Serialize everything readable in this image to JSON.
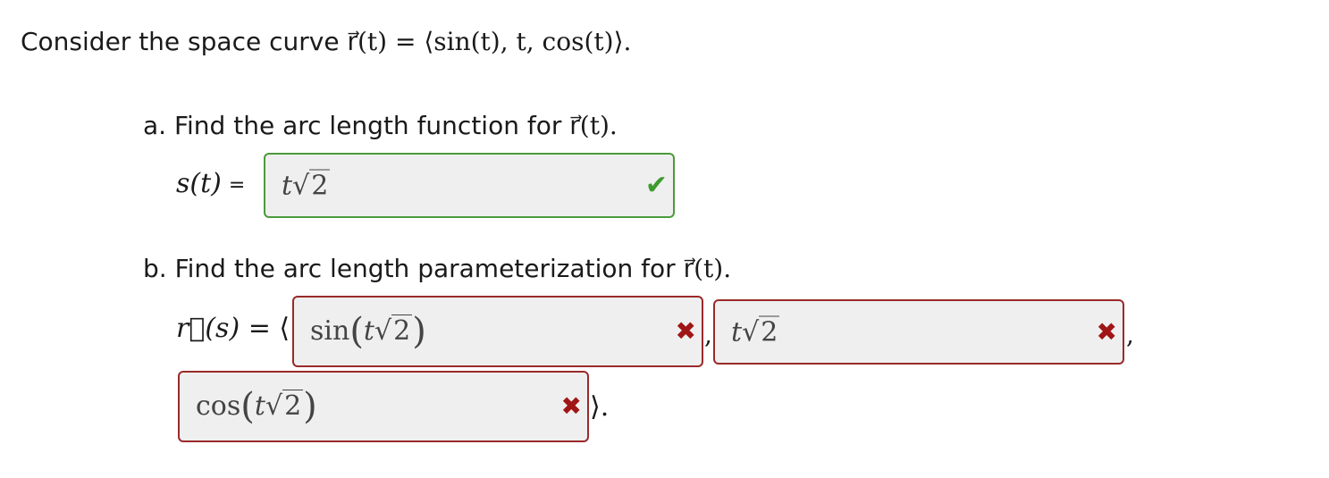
{
  "intro": {
    "text": "Consider the space curve ",
    "vector": "r⃗(t) = ⟨sin(t), t, cos(t)⟩."
  },
  "part_a": {
    "prompt": "a. Find the arc length function for ",
    "prompt_vector": "r⃗(t).",
    "label": "s(t)",
    "equals": "=",
    "answer": {
      "coef": "t",
      "root": "2"
    },
    "status": "correct"
  },
  "part_b": {
    "prompt": "b. Find the arc length parameterization for ",
    "prompt_vector": "r⃗(t).",
    "label": "r⃗(s)",
    "equals": "=",
    "open": "⟨",
    "comma": ",",
    "close": "⟩.",
    "answers": [
      {
        "func": "sin",
        "coef": "t",
        "root": "2",
        "status": "incorrect"
      },
      {
        "func": "",
        "coef": "t",
        "root": "2",
        "status": "incorrect"
      },
      {
        "func": "cos",
        "coef": "t",
        "root": "2",
        "status": "incorrect"
      }
    ]
  },
  "icons": {
    "correct": "check-icon",
    "incorrect": "x-icon"
  },
  "colors": {
    "correct": "#4c9a3c",
    "incorrect": "#9a2a2a"
  }
}
